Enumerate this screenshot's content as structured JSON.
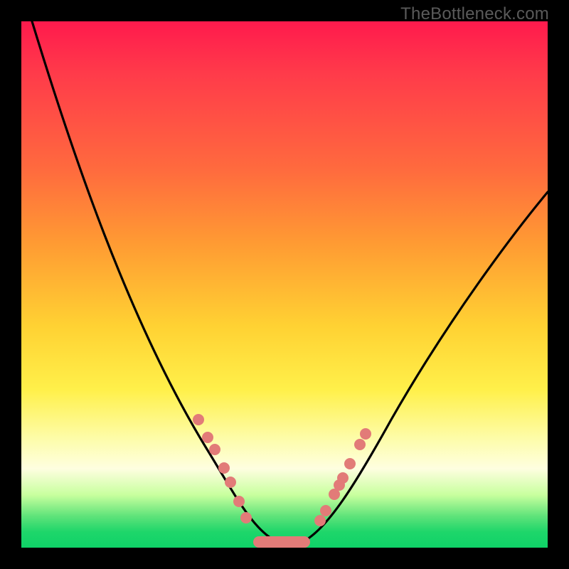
{
  "watermark": "TheBottleneck.com",
  "colors": {
    "dot": "#e27b78",
    "curve": "#000000",
    "gradient_top": "#ff1a4d",
    "gradient_mid": "#ffd233",
    "gradient_bottom": "#0fd268",
    "frame": "#000000"
  },
  "chart_data": {
    "type": "line",
    "title": "",
    "xlabel": "",
    "ylabel": "",
    "xlim": [
      0,
      100
    ],
    "ylim": [
      0,
      100
    ],
    "grid": false,
    "legend": false,
    "series": [
      {
        "name": "bottleneck-curve",
        "x": [
          2,
          6,
          10,
          14,
          18,
          22,
          26,
          30,
          34,
          37,
          40,
          43,
          45,
          47,
          49,
          51,
          53,
          55,
          58,
          62,
          66,
          70,
          74,
          78,
          82,
          86,
          90,
          94,
          98
        ],
        "y": [
          100,
          93,
          85,
          77,
          69,
          60,
          51,
          42,
          33,
          25,
          18,
          11,
          6,
          3,
          1,
          1,
          3,
          7,
          13,
          21,
          29,
          36,
          43,
          49,
          55,
          60,
          64,
          67,
          69
        ]
      }
    ],
    "markers": {
      "left_branch": [
        {
          "x": 34,
          "y": 33
        },
        {
          "x": 36,
          "y": 28
        },
        {
          "x": 37,
          "y": 25
        },
        {
          "x": 39,
          "y": 20
        },
        {
          "x": 40,
          "y": 17
        },
        {
          "x": 42,
          "y": 12
        },
        {
          "x": 43,
          "y": 9
        }
      ],
      "right_branch": [
        {
          "x": 56,
          "y": 9
        },
        {
          "x": 57,
          "y": 12
        },
        {
          "x": 59,
          "y": 16
        },
        {
          "x": 60,
          "y": 18
        },
        {
          "x": 60.5,
          "y": 20
        },
        {
          "x": 62,
          "y": 23
        },
        {
          "x": 64,
          "y": 27
        },
        {
          "x": 65,
          "y": 29
        }
      ],
      "bottom_bar": {
        "x_start": 45,
        "x_end": 53,
        "y": 1
      }
    }
  }
}
